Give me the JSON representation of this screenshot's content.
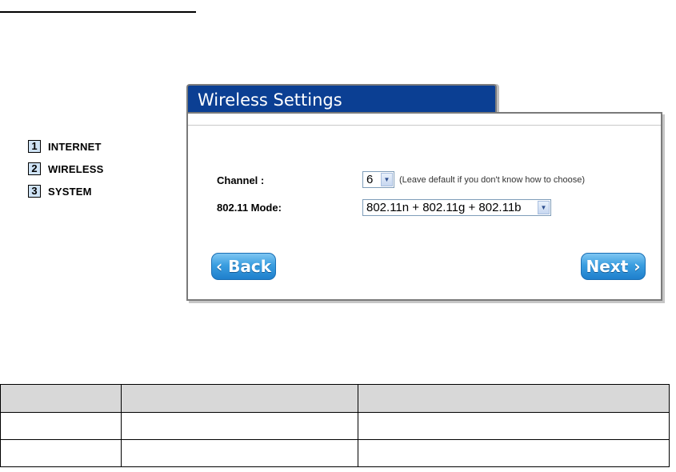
{
  "wizard": {
    "steps": [
      {
        "number": "1",
        "label": "INTERNET"
      },
      {
        "number": "2",
        "label": "WIRELESS"
      },
      {
        "number": "3",
        "label": "SYSTEM"
      }
    ]
  },
  "panel": {
    "title": "Wireless Settings",
    "channel": {
      "label": "Channel :",
      "value": "6",
      "hint": "(Leave default if you don't know how to choose)"
    },
    "mode": {
      "label": "802.11 Mode:",
      "value": "802.11n + 802.11g + 802.11b"
    },
    "back_label": "‹ Back",
    "next_label": "Next ›"
  },
  "table": {
    "rows": [
      [
        "",
        "",
        ""
      ],
      [
        "",
        "",
        ""
      ],
      [
        "",
        "",
        ""
      ]
    ]
  }
}
